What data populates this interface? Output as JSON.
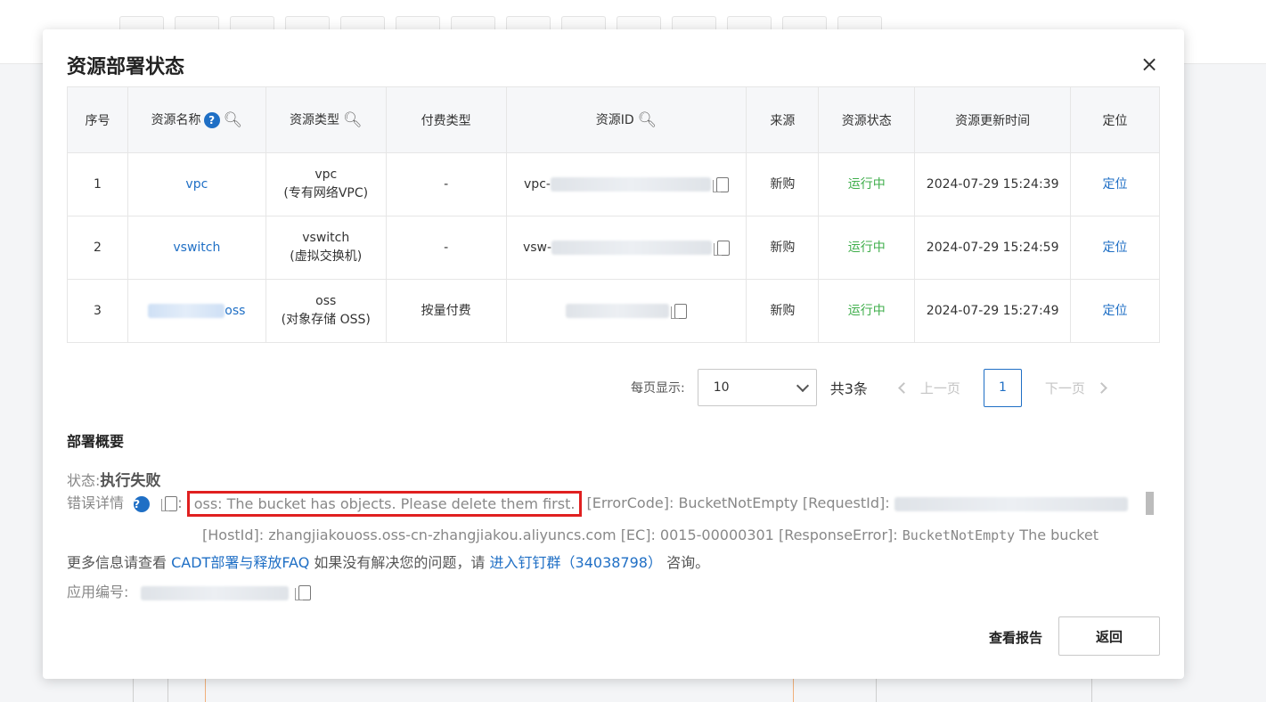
{
  "modal": {
    "title": "资源部署状态",
    "close_icon": "×"
  },
  "table": {
    "headers": {
      "index": "序号",
      "name": "资源名称",
      "type": "资源类型",
      "billing": "付费类型",
      "id": "资源ID",
      "source": "来源",
      "status": "资源状态",
      "updated": "资源更新时间",
      "locate": "定位"
    },
    "rows": [
      {
        "index": "1",
        "name": "vpc",
        "type_main": "vpc",
        "type_sub": "(专有网络VPC)",
        "billing": "-",
        "id_prefix": "vpc-",
        "source": "新购",
        "status": "运行中",
        "updated": "2024-07-29 15:24:39",
        "locate": "定位"
      },
      {
        "index": "2",
        "name": "vswitch",
        "type_main": "vswitch",
        "type_sub": "(虚拟交换机)",
        "billing": "-",
        "id_prefix": "vsw-",
        "source": "新购",
        "status": "运行中",
        "updated": "2024-07-29 15:24:59",
        "locate": "定位"
      },
      {
        "index": "3",
        "name": "oss",
        "type_main": "oss",
        "type_sub": "(对象存储 OSS)",
        "billing": "按量付费",
        "id_prefix": "",
        "source": "新购",
        "status": "运行中",
        "updated": "2024-07-29 15:27:49",
        "locate": "定位"
      }
    ]
  },
  "pager": {
    "per_page_label": "每页显示:",
    "per_page_value": "10",
    "total": "共3条",
    "prev": "上一页",
    "current": "1",
    "next": "下一页"
  },
  "summary": {
    "title": "部署概要",
    "status_label": "状态:",
    "status_value": "执行失败",
    "error_label": "错误详情",
    "colon": ":",
    "error_highlight": "oss: The bucket has objects. Please delete them first.",
    "error_rest": "[ErrorCode]: BucketNotEmpty [RequestId]:",
    "error_line2": "[HostId]: zhangjiakouoss.oss-cn-zhangjiakou.aliyuncs.com [EC]: 0015-00000301 [ResponseError]:",
    "error_line2_mono": "BucketNotEmpty",
    "error_line2_tail": "The bucket",
    "more_prefix": "更多信息请查看",
    "more_link": "CADT部署与释放FAQ",
    "more_mid": "如果没有解决您的问题，请",
    "more_link2": "进入钉钉群（34038798）",
    "more_suffix": "咨询。",
    "app_id_label": "应用编号:"
  },
  "footer": {
    "view_report": "查看报告",
    "back": "返回"
  },
  "colors": {
    "link": "#1f6fc5",
    "running": "#3fae4b",
    "error_border": "#e02020"
  }
}
